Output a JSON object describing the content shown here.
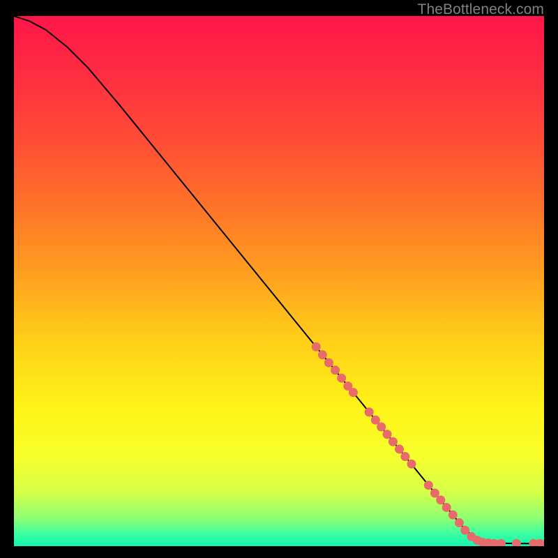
{
  "watermark": "TheBottleneck.com",
  "gradient_stops": [
    {
      "offset": 0.0,
      "color": "#ff1549"
    },
    {
      "offset": 0.12,
      "color": "#ff2f41"
    },
    {
      "offset": 0.25,
      "color": "#ff5134"
    },
    {
      "offset": 0.38,
      "color": "#ff7a27"
    },
    {
      "offset": 0.5,
      "color": "#ffa41e"
    },
    {
      "offset": 0.62,
      "color": "#ffd218"
    },
    {
      "offset": 0.74,
      "color": "#fef318"
    },
    {
      "offset": 0.83,
      "color": "#f7ff2c"
    },
    {
      "offset": 0.9,
      "color": "#d4ff48"
    },
    {
      "offset": 0.95,
      "color": "#8aff76"
    },
    {
      "offset": 0.975,
      "color": "#3eff9f"
    },
    {
      "offset": 1.0,
      "color": "#11f7b0"
    }
  ],
  "chart_data": {
    "type": "line",
    "title": "",
    "xlabel": "",
    "ylabel": "",
    "xlim": [
      0,
      100
    ],
    "ylim": [
      0,
      100
    ],
    "curve": [
      {
        "x": 0,
        "y": 100
      },
      {
        "x": 3,
        "y": 99.0
      },
      {
        "x": 6,
        "y": 97.4
      },
      {
        "x": 10,
        "y": 94.2
      },
      {
        "x": 14,
        "y": 90.2
      },
      {
        "x": 20,
        "y": 83.1
      },
      {
        "x": 30,
        "y": 70.8
      },
      {
        "x": 40,
        "y": 58.5
      },
      {
        "x": 50,
        "y": 46.2
      },
      {
        "x": 60,
        "y": 33.9
      },
      {
        "x": 70,
        "y": 21.6
      },
      {
        "x": 80,
        "y": 9.3
      },
      {
        "x": 85,
        "y": 3.2
      },
      {
        "x": 87.5,
        "y": 1.2
      },
      {
        "x": 90,
        "y": 0.6
      },
      {
        "x": 95,
        "y": 0.5
      },
      {
        "x": 100,
        "y": 0.5
      }
    ],
    "markers_color": "#e86a6a",
    "markers": [
      {
        "x": 57.0,
        "y": 37.6
      },
      {
        "x": 58.2,
        "y": 36.1
      },
      {
        "x": 59.4,
        "y": 34.6
      },
      {
        "x": 60.6,
        "y": 33.2
      },
      {
        "x": 61.8,
        "y": 31.7
      },
      {
        "x": 63.0,
        "y": 30.2
      },
      {
        "x": 64.0,
        "y": 29.0
      },
      {
        "x": 67.0,
        "y": 25.3
      },
      {
        "x": 68.2,
        "y": 23.8
      },
      {
        "x": 69.3,
        "y": 22.5
      },
      {
        "x": 70.4,
        "y": 21.1
      },
      {
        "x": 71.5,
        "y": 19.7
      },
      {
        "x": 72.7,
        "y": 18.3
      },
      {
        "x": 73.8,
        "y": 16.9
      },
      {
        "x": 75.0,
        "y": 15.5
      },
      {
        "x": 78.2,
        "y": 11.5
      },
      {
        "x": 79.4,
        "y": 10.0
      },
      {
        "x": 80.5,
        "y": 8.7
      },
      {
        "x": 81.6,
        "y": 7.3
      },
      {
        "x": 82.8,
        "y": 5.9
      },
      {
        "x": 84.0,
        "y": 4.4
      },
      {
        "x": 85.1,
        "y": 3.0
      },
      {
        "x": 86.3,
        "y": 1.8
      },
      {
        "x": 87.4,
        "y": 1.1
      },
      {
        "x": 88.4,
        "y": 0.7
      },
      {
        "x": 89.5,
        "y": 0.6
      },
      {
        "x": 90.6,
        "y": 0.5
      },
      {
        "x": 91.9,
        "y": 0.5
      },
      {
        "x": 94.8,
        "y": 0.5
      },
      {
        "x": 98.0,
        "y": 0.5
      },
      {
        "x": 99.2,
        "y": 0.5
      }
    ]
  }
}
